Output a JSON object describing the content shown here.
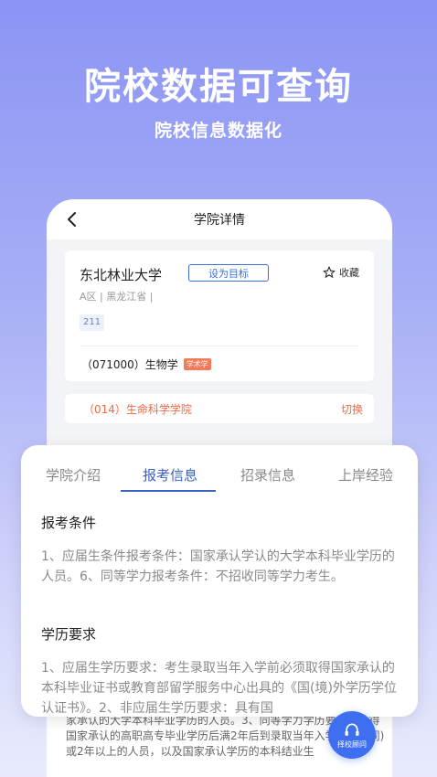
{
  "hero": {
    "title": "院校数据可查询",
    "subtitle": "院校信息数据化"
  },
  "screen": {
    "title": "学院详情"
  },
  "university": {
    "name": "东北林业大学",
    "target_label": "设为目标",
    "favorite_label": "收藏",
    "meta": "A区 | 黑龙江省 |",
    "tag": "211",
    "major": "（071000）生物学",
    "major_tag": "学术学"
  },
  "college": {
    "name": "（014）生命科学学院",
    "switch_label": "切换"
  },
  "tabs": [
    {
      "label": "学院介绍",
      "active": false
    },
    {
      "label": "报考信息",
      "active": true
    },
    {
      "label": "招录信息",
      "active": false
    },
    {
      "label": "上岸经验",
      "active": false
    }
  ],
  "sections": {
    "conditions_title": "报考条件",
    "conditions_text": "1、应届生条件报考条件：国家承认学认的大学本科毕业学历的人员。6、同等学力报考条件：不招收同等学力考生。",
    "education_title": "学历要求",
    "education_text": "1、应届生学历要求：考生录取当年入学前必须取得国家承认的本科毕业证书或教育部留学服务中心出具的《国(境)外学历学位认证书》。2、非应届生学历要求：具有国"
  },
  "below_text": "家承认的大学本科毕业学历的人员。3、同等学力学历要求：获得国家承认的高职高专毕业学历后满2年后到录取当年入学前，下同)或2年以上的人员，以及国家承认学历的本科结业生",
  "consult_label": "择校顾问",
  "colors": {
    "accent": "#3a62c2",
    "orange": "#ef6a47",
    "consult": "#3d6ff0"
  }
}
